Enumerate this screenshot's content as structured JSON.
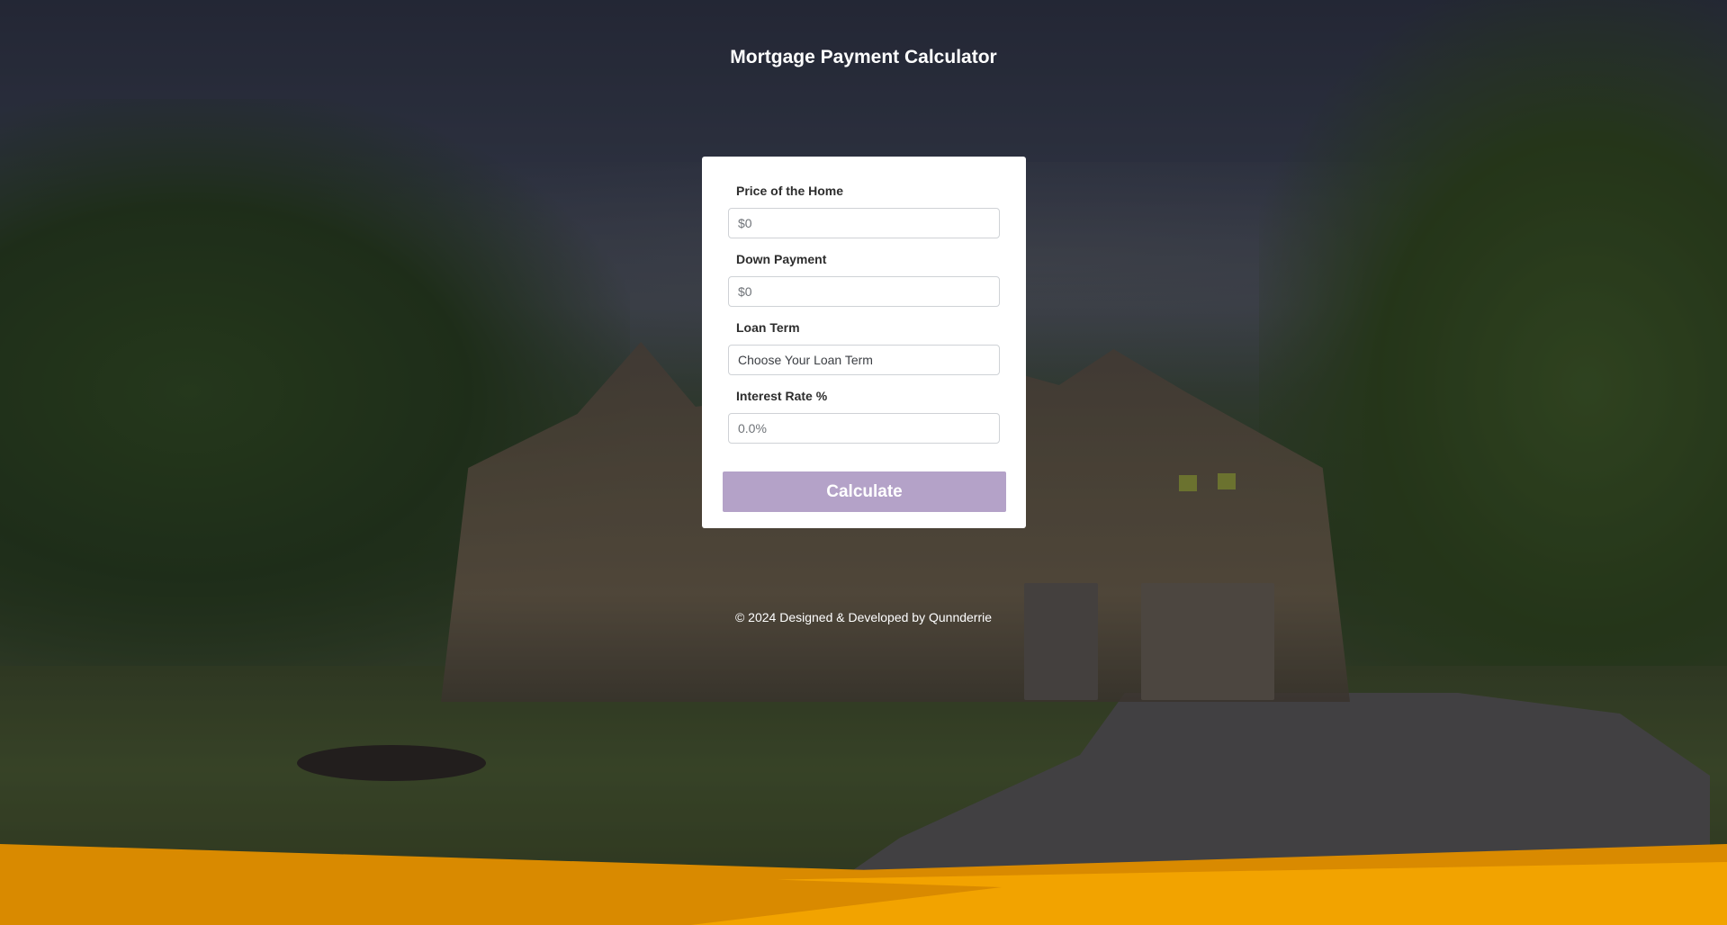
{
  "header": {
    "title": "Mortgage Payment Calculator"
  },
  "form": {
    "home_price": {
      "label": "Price of the Home",
      "placeholder": "$0"
    },
    "down_payment": {
      "label": "Down Payment",
      "placeholder": "$0"
    },
    "loan_term": {
      "label": "Loan Term",
      "selected": "Choose Your Loan Term"
    },
    "interest_rate": {
      "label": "Interest Rate %",
      "placeholder": "0.0%"
    },
    "calculate_label": "Calculate"
  },
  "footer": {
    "text": "© 2024 Designed & Developed by Qunnderrie"
  },
  "colors": {
    "button": "#b4a2c8",
    "wave_front": "#f2a300",
    "wave_back": "#d98a00"
  }
}
